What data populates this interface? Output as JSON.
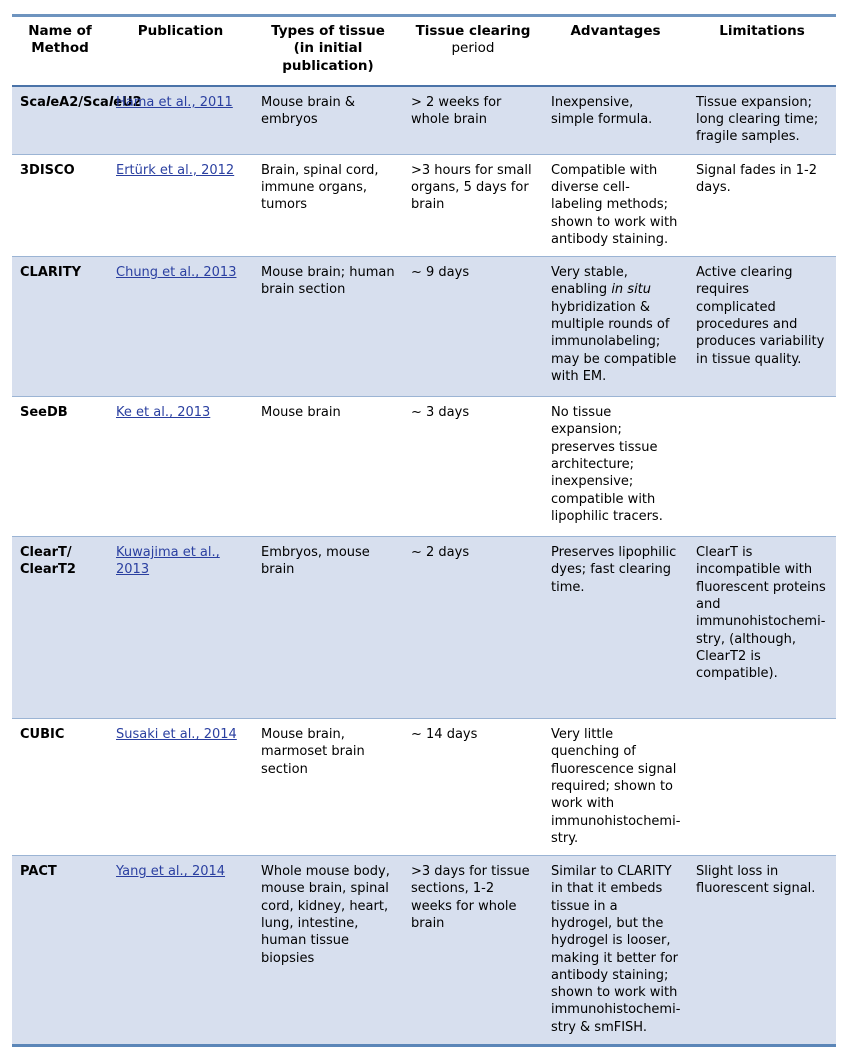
{
  "table": {
    "headers": [
      {
        "main": "Name of Method",
        "sub": ""
      },
      {
        "main": "Publication",
        "sub": ""
      },
      {
        "main": "Types of tissue",
        "sub": "(in initial publication)"
      },
      {
        "main": "Tissue clearing",
        "sub": "period"
      },
      {
        "main": "Advantages",
        "sub": ""
      },
      {
        "main": "Limitations",
        "sub": ""
      }
    ],
    "header_labels": {
      "name_of_method": "Name of Method",
      "publication": "Publication",
      "types_of_tissue_main": "Types of tissue",
      "types_of_tissue_sub": "(in initial publication)",
      "tissue_clearing_main": "Tissue clearing",
      "tissue_clearing_sub": "period",
      "advantages": "Advantages",
      "limitations": "Limitations"
    },
    "rows": [
      {
        "method": "ScaleA2/ ScaleU2",
        "method_parts": [
          "Sca",
          "l",
          "eA2/",
          "Sca",
          "l",
          "eU2"
        ],
        "publication": "Hama et al., 2011",
        "tissue": "Mouse brain & embryos",
        "period": "> 2 weeks for whole brain",
        "advantages": "Inexpensive, simple formula.",
        "limitations": "Tissue expansion; long clearing time; fragile samples.",
        "shaded": true
      },
      {
        "method": "3DISCO",
        "publication": "Ertürk et al., 2012",
        "tissue": "Brain, spinal cord, immune organs, tumors",
        "period": ">3 hours for small organs, 5 days for brain",
        "advantages": "Compatible with diverse cell-labeling methods; shown to work with antibody staining.",
        "limitations": "Signal fades in 1-2 days.",
        "shaded": false
      },
      {
        "method": "CLARITY",
        "publication": "Chung et al., 2013",
        "tissue": "Mouse brain; human brain section",
        "period": "~ 9 days",
        "advantages_pre": "Very stable, enabling ",
        "advantages_italic": "in situ",
        "advantages_post": " hybridization & multiple rounds of immunolabeling; may be compatible with EM.",
        "advantages": "Very stable, enabling in situ hybridization & multiple rounds of immunolabeling; may be compatible with EM.",
        "limitations": "Active clearing requires complicated procedures and produces variability in tissue quality.",
        "shaded": true
      },
      {
        "method": "SeeDB",
        "publication": "Ke et al., 2013",
        "tissue": "Mouse brain",
        "period": "~ 3 days",
        "advantages": "No tissue expansion; preserves tissue architecture; inexpensive; compatible with lipophilic tracers.",
        "limitations": "",
        "shaded": false
      },
      {
        "method": "ClearT/ ClearT2",
        "publication": "Kuwajima et al., 2013",
        "tissue": "Embryos, mouse brain",
        "period": "~ 2 days",
        "advantages": "Preserves lipophilic dyes; fast clearing time.",
        "limitations": "ClearT is incompatible with fluorescent proteins and immunohistochemi-stry, (although, ClearT2 is compatible).",
        "shaded": true
      },
      {
        "method": "CUBIC",
        "publication": "Susaki et al., 2014",
        "tissue": "Mouse brain, marmoset brain section",
        "period": "~ 14 days",
        "advantages": "Very little quenching of fluorescence signal required; shown to work with immunohistochemi-stry.",
        "limitations": "",
        "shaded": false
      },
      {
        "method": "PACT",
        "publication": "Yang et al., 2014",
        "tissue": "Whole mouse body, mouse brain, spinal cord, kidney, heart, lung, intestine, human tissue biopsies",
        "period": ">3 days for tissue sections, 1-2 weeks for whole brain",
        "advantages": "Similar to CLARITY in that it embeds tissue in a hydrogel, but the hydrogel is looser, making it better for antibody staining; shown to work with immunohistochemi-stry & smFISH.",
        "limitations": "Slight loss in fluorescent signal.",
        "shaded": true
      }
    ]
  },
  "colors": {
    "shaded_row_background": "#d7dfee",
    "top_border": "#6e94bf",
    "header_rule": "#4a73a8",
    "row_rule": "#9bb4d4",
    "bottom_border": "#5b86b8",
    "link_text": "#2a3fa0",
    "body_text": "#000000",
    "page_background": "#ffffff"
  }
}
